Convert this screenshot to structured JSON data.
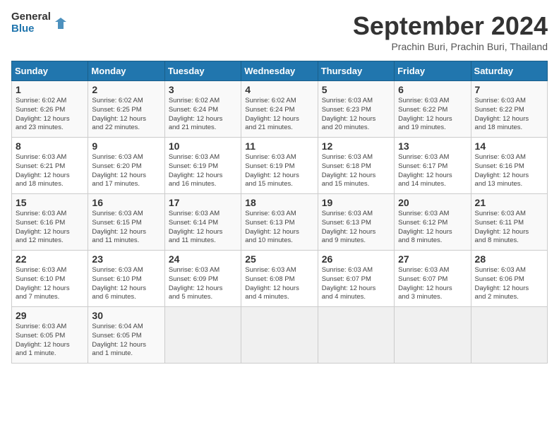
{
  "logo": {
    "line1": "General",
    "line2": "Blue"
  },
  "title": "September 2024",
  "subtitle": "Prachin Buri, Prachin Buri, Thailand",
  "weekdays": [
    "Sunday",
    "Monday",
    "Tuesday",
    "Wednesday",
    "Thursday",
    "Friday",
    "Saturday"
  ],
  "weeks": [
    [
      {
        "day": "1",
        "lines": [
          "Sunrise: 6:02 AM",
          "Sunset: 6:26 PM",
          "Daylight: 12 hours",
          "and 23 minutes."
        ]
      },
      {
        "day": "2",
        "lines": [
          "Sunrise: 6:02 AM",
          "Sunset: 6:25 PM",
          "Daylight: 12 hours",
          "and 22 minutes."
        ]
      },
      {
        "day": "3",
        "lines": [
          "Sunrise: 6:02 AM",
          "Sunset: 6:24 PM",
          "Daylight: 12 hours",
          "and 21 minutes."
        ]
      },
      {
        "day": "4",
        "lines": [
          "Sunrise: 6:02 AM",
          "Sunset: 6:24 PM",
          "Daylight: 12 hours",
          "and 21 minutes."
        ]
      },
      {
        "day": "5",
        "lines": [
          "Sunrise: 6:03 AM",
          "Sunset: 6:23 PM",
          "Daylight: 12 hours",
          "and 20 minutes."
        ]
      },
      {
        "day": "6",
        "lines": [
          "Sunrise: 6:03 AM",
          "Sunset: 6:22 PM",
          "Daylight: 12 hours",
          "and 19 minutes."
        ]
      },
      {
        "day": "7",
        "lines": [
          "Sunrise: 6:03 AM",
          "Sunset: 6:22 PM",
          "Daylight: 12 hours",
          "and 18 minutes."
        ]
      }
    ],
    [
      {
        "day": "8",
        "lines": [
          "Sunrise: 6:03 AM",
          "Sunset: 6:21 PM",
          "Daylight: 12 hours",
          "and 18 minutes."
        ]
      },
      {
        "day": "9",
        "lines": [
          "Sunrise: 6:03 AM",
          "Sunset: 6:20 PM",
          "Daylight: 12 hours",
          "and 17 minutes."
        ]
      },
      {
        "day": "10",
        "lines": [
          "Sunrise: 6:03 AM",
          "Sunset: 6:19 PM",
          "Daylight: 12 hours",
          "and 16 minutes."
        ]
      },
      {
        "day": "11",
        "lines": [
          "Sunrise: 6:03 AM",
          "Sunset: 6:19 PM",
          "Daylight: 12 hours",
          "and 15 minutes."
        ]
      },
      {
        "day": "12",
        "lines": [
          "Sunrise: 6:03 AM",
          "Sunset: 6:18 PM",
          "Daylight: 12 hours",
          "and 15 minutes."
        ]
      },
      {
        "day": "13",
        "lines": [
          "Sunrise: 6:03 AM",
          "Sunset: 6:17 PM",
          "Daylight: 12 hours",
          "and 14 minutes."
        ]
      },
      {
        "day": "14",
        "lines": [
          "Sunrise: 6:03 AM",
          "Sunset: 6:16 PM",
          "Daylight: 12 hours",
          "and 13 minutes."
        ]
      }
    ],
    [
      {
        "day": "15",
        "lines": [
          "Sunrise: 6:03 AM",
          "Sunset: 6:16 PM",
          "Daylight: 12 hours",
          "and 12 minutes."
        ]
      },
      {
        "day": "16",
        "lines": [
          "Sunrise: 6:03 AM",
          "Sunset: 6:15 PM",
          "Daylight: 12 hours",
          "and 11 minutes."
        ]
      },
      {
        "day": "17",
        "lines": [
          "Sunrise: 6:03 AM",
          "Sunset: 6:14 PM",
          "Daylight: 12 hours",
          "and 11 minutes."
        ]
      },
      {
        "day": "18",
        "lines": [
          "Sunrise: 6:03 AM",
          "Sunset: 6:13 PM",
          "Daylight: 12 hours",
          "and 10 minutes."
        ]
      },
      {
        "day": "19",
        "lines": [
          "Sunrise: 6:03 AM",
          "Sunset: 6:13 PM",
          "Daylight: 12 hours",
          "and 9 minutes."
        ]
      },
      {
        "day": "20",
        "lines": [
          "Sunrise: 6:03 AM",
          "Sunset: 6:12 PM",
          "Daylight: 12 hours",
          "and 8 minutes."
        ]
      },
      {
        "day": "21",
        "lines": [
          "Sunrise: 6:03 AM",
          "Sunset: 6:11 PM",
          "Daylight: 12 hours",
          "and 8 minutes."
        ]
      }
    ],
    [
      {
        "day": "22",
        "lines": [
          "Sunrise: 6:03 AM",
          "Sunset: 6:10 PM",
          "Daylight: 12 hours",
          "and 7 minutes."
        ]
      },
      {
        "day": "23",
        "lines": [
          "Sunrise: 6:03 AM",
          "Sunset: 6:10 PM",
          "Daylight: 12 hours",
          "and 6 minutes."
        ]
      },
      {
        "day": "24",
        "lines": [
          "Sunrise: 6:03 AM",
          "Sunset: 6:09 PM",
          "Daylight: 12 hours",
          "and 5 minutes."
        ]
      },
      {
        "day": "25",
        "lines": [
          "Sunrise: 6:03 AM",
          "Sunset: 6:08 PM",
          "Daylight: 12 hours",
          "and 4 minutes."
        ]
      },
      {
        "day": "26",
        "lines": [
          "Sunrise: 6:03 AM",
          "Sunset: 6:07 PM",
          "Daylight: 12 hours",
          "and 4 minutes."
        ]
      },
      {
        "day": "27",
        "lines": [
          "Sunrise: 6:03 AM",
          "Sunset: 6:07 PM",
          "Daylight: 12 hours",
          "and 3 minutes."
        ]
      },
      {
        "day": "28",
        "lines": [
          "Sunrise: 6:03 AM",
          "Sunset: 6:06 PM",
          "Daylight: 12 hours",
          "and 2 minutes."
        ]
      }
    ],
    [
      {
        "day": "29",
        "lines": [
          "Sunrise: 6:03 AM",
          "Sunset: 6:05 PM",
          "Daylight: 12 hours",
          "and 1 minute."
        ]
      },
      {
        "day": "30",
        "lines": [
          "Sunrise: 6:04 AM",
          "Sunset: 6:05 PM",
          "Daylight: 12 hours",
          "and 1 minute."
        ]
      },
      null,
      null,
      null,
      null,
      null
    ]
  ]
}
